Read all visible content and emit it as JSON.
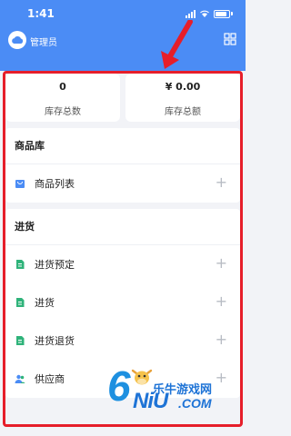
{
  "status_bar": {
    "time": "1:41"
  },
  "app_bar": {
    "title": "管理员"
  },
  "stats": [
    {
      "value": "0",
      "label": "库存总数"
    },
    {
      "value": "¥ 0.00",
      "label": "库存总额"
    }
  ],
  "sections": [
    {
      "title": "商品库",
      "items": [
        {
          "label": "商品列表",
          "icon": "bag-icon"
        }
      ]
    },
    {
      "title": "进货",
      "items": [
        {
          "label": "进货预定",
          "icon": "document-icon"
        },
        {
          "label": "进货",
          "icon": "document-icon"
        },
        {
          "label": "进货退货",
          "icon": "document-icon"
        },
        {
          "label": "供应商",
          "icon": "people-icon"
        }
      ]
    }
  ],
  "watermark": {
    "big_six": "6",
    "niu": "NiU",
    "com": ".COM",
    "cn": "乐牛游戏网"
  },
  "colors": {
    "header": "#4b8cf5",
    "annotation": "#e61e2a",
    "icon_green": "#2fb37a",
    "icon_blue": "#4b8cf5"
  }
}
